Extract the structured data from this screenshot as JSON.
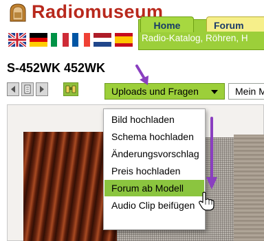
{
  "header": {
    "logo_text": "Radiomuseum",
    "tabs": [
      {
        "label": "Home"
      },
      {
        "label": "Forum"
      }
    ],
    "nav_links": "Radio-Katalog, Röhren, H",
    "flags": [
      "uk-flag",
      "german-flag",
      "italian-flag",
      "french-flag",
      "dutch-flag",
      "spanish-flag"
    ]
  },
  "page": {
    "title": "S-452WK 452WK"
  },
  "toolbar": {
    "uploads_label": "Uploads und Fragen",
    "model_label": "Mein M"
  },
  "menu": {
    "items": [
      {
        "label": "Bild hochladen"
      },
      {
        "label": "Schema hochladen"
      },
      {
        "label": "Änderungsvorschlag"
      },
      {
        "label": "Preis hochladen"
      },
      {
        "label": "Forum ab Modell",
        "active": true
      },
      {
        "label": "Audio Clip beifügen"
      }
    ]
  },
  "colors": {
    "accent_green": "#9ccf3a",
    "logo_red": "#b8281c",
    "annotation_purple": "#8a3fc0",
    "menu_active": "#8bc53f"
  }
}
